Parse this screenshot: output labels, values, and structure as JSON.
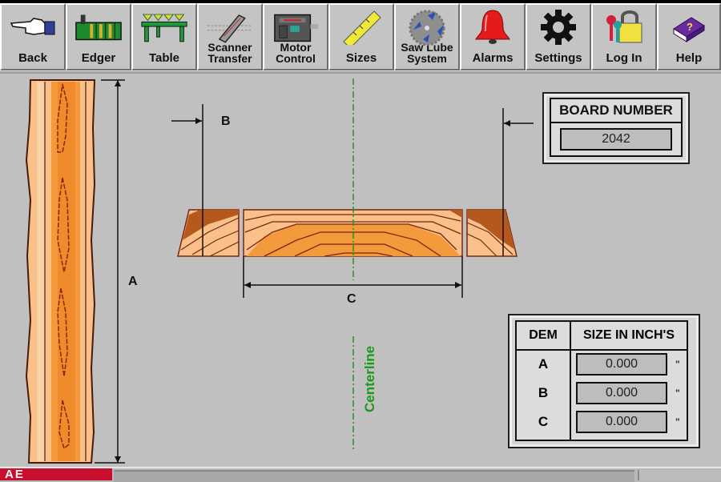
{
  "toolbar": {
    "buttons": [
      {
        "id": "back",
        "label": "Back",
        "icon": "pointing-hand-icon"
      },
      {
        "id": "edger",
        "label": "Edger",
        "icon": "edger-machine-icon"
      },
      {
        "id": "table",
        "label": "Table",
        "icon": "table-conveyor-icon"
      },
      {
        "id": "scanner",
        "label": "Scanner Transfer",
        "line1": "Scanner",
        "line2": "Transfer",
        "icon": "scanner-icon"
      },
      {
        "id": "motor",
        "label": "Motor Control",
        "line1": "Motor",
        "line2": "Control",
        "icon": "motor-icon"
      },
      {
        "id": "sizes",
        "label": "Sizes",
        "icon": "ruler-icon"
      },
      {
        "id": "sawlube",
        "label": "Saw Lube System",
        "line1": "Saw Lube",
        "line2": "System",
        "icon": "saw-blade-icon"
      },
      {
        "id": "alarms",
        "label": "Alarms",
        "icon": "bell-icon"
      },
      {
        "id": "settings",
        "label": "Settings",
        "icon": "gear-icon"
      },
      {
        "id": "login",
        "label": "Log In",
        "icon": "padlock-keys-icon"
      },
      {
        "id": "help",
        "label": "Help",
        "icon": "help-book-icon"
      }
    ]
  },
  "diagram": {
    "dim_a_label": "A",
    "dim_b_label": "B",
    "dim_c_label": "C",
    "centerline_label": "Centerline",
    "centerline_color": "#1a9a1a"
  },
  "board_number": {
    "title": "BOARD NUMBER",
    "value": "2042"
  },
  "dimensions": {
    "header_dem": "DEM",
    "header_size": "SIZE IN INCH'S",
    "unit_mark": "\"",
    "rows": [
      {
        "dem": "A",
        "value": "0.000"
      },
      {
        "dem": "B",
        "value": "0.000"
      },
      {
        "dem": "C",
        "value": "0.000"
      }
    ]
  },
  "status_bar": {
    "logo_text": "AE"
  },
  "colors": {
    "wood_light": "#f9c08a",
    "wood_mid": "#f39a3c",
    "wood_dark": "#b5581e",
    "grain_line": "#7a2410",
    "alarm_red": "#e51b1b"
  }
}
